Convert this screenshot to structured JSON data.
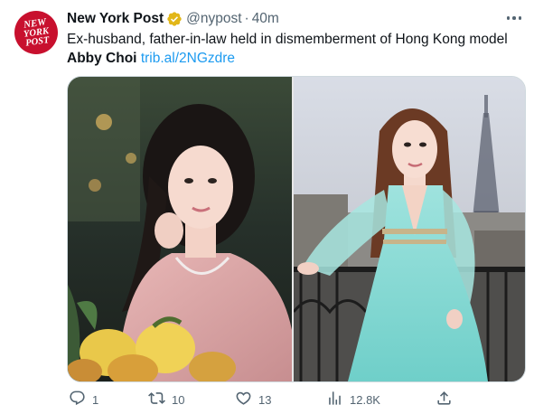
{
  "tweet": {
    "author_name": "New York Post",
    "handle": "@nypost",
    "separator": "·",
    "time": "40m",
    "text_prefix": "Ex-husband, father-in-law held in dismemberment of Hong Kong model ",
    "text_bold": "Abby Choi",
    "link_text": "trib.al/2NGzdre"
  },
  "avatar": {
    "logo_lines": [
      "NEW",
      "YORK",
      "POST"
    ]
  },
  "colors": {
    "brand_red": "#c8102e",
    "verified_gold": "#e2b719",
    "link_blue": "#1d9bf0",
    "muted_gray": "#536471"
  },
  "actions": {
    "replies": "1",
    "retweets": "10",
    "likes": "13",
    "views": "12.8K"
  },
  "icons": {
    "more": "more-horizontal-icon",
    "verified": "verified-badge-icon",
    "reply": "reply-icon",
    "retweet": "retweet-icon",
    "like": "heart-icon",
    "views": "views-chart-icon",
    "share": "share-icon"
  }
}
